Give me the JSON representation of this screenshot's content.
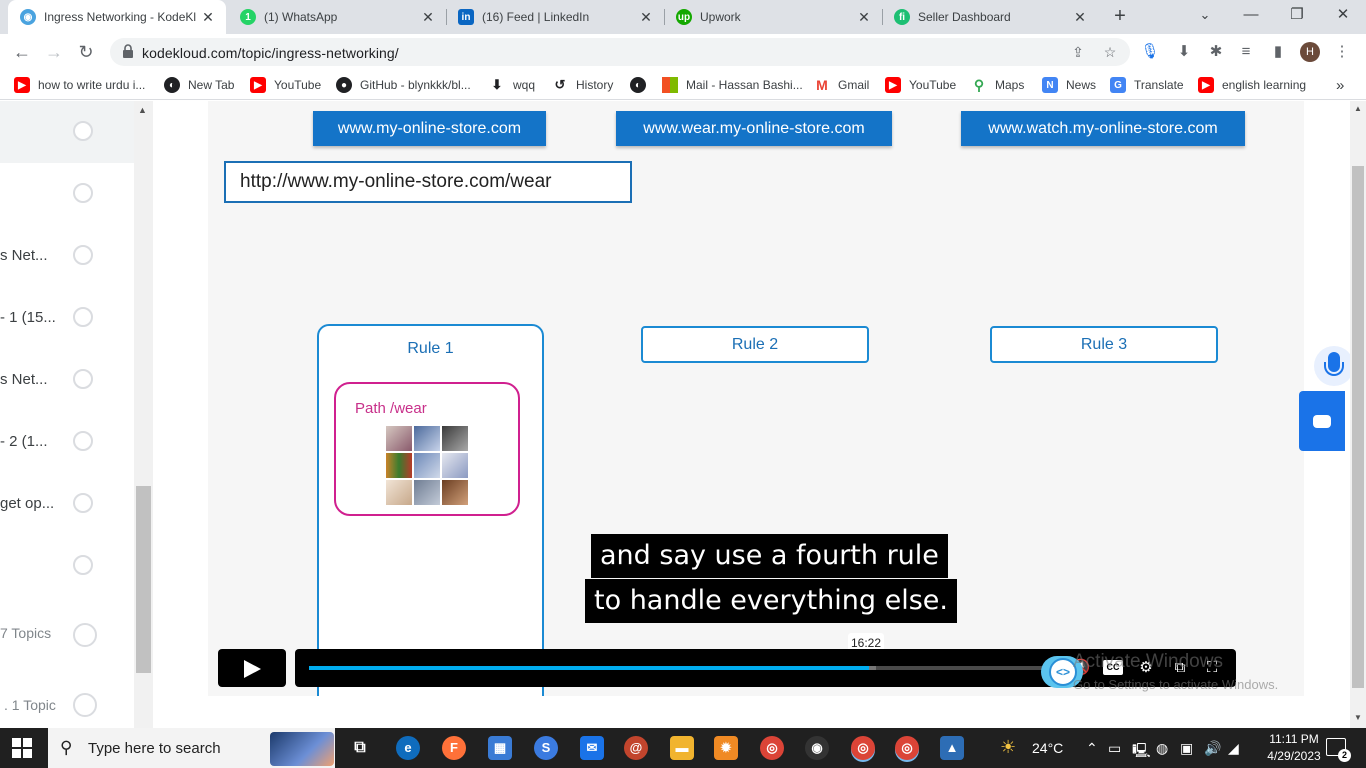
{
  "browser": {
    "tabs": [
      {
        "title": "Ingress Networking - KodeKl",
        "active": true,
        "icon": "kodekloud-icon",
        "color": "#4aa3df"
      },
      {
        "title": "(1) WhatsApp",
        "active": false,
        "icon": "whatsapp-icon",
        "color": "#25d366"
      },
      {
        "title": "(16) Feed | LinkedIn",
        "active": false,
        "icon": "linkedin-icon",
        "color": "#0a66c2"
      },
      {
        "title": "Upwork",
        "active": false,
        "icon": "upwork-icon",
        "color": "#14a800"
      },
      {
        "title": "Seller Dashboard",
        "active": false,
        "icon": "fiverr-icon",
        "color": "#1dbf73"
      }
    ],
    "new_tab": "+",
    "window_controls": {
      "minimize": "—",
      "restore": "❐",
      "close": "✕"
    },
    "url": "kodekloud.com/topic/ingress-networking/",
    "bookmarks": [
      {
        "label": "how to write urdu i...",
        "icon": "youtube-icon",
        "color": "#ff0000"
      },
      {
        "label": "New Tab",
        "icon": "globe-icon",
        "color": "#202124"
      },
      {
        "label": "YouTube",
        "icon": "youtube-icon",
        "color": "#ff0000"
      },
      {
        "label": "GitHub - blynkkk/bl...",
        "icon": "github-icon",
        "color": "#202124"
      },
      {
        "label": "wqq",
        "icon": "download-icon",
        "color": "#202124"
      },
      {
        "label": "History",
        "icon": "history-icon",
        "color": "#202124"
      },
      {
        "label": "",
        "icon": "globe-icon",
        "color": "#202124"
      },
      {
        "label": "Mail - Hassan Bashi...",
        "icon": "microsoft-icon",
        "color": "#f25022"
      },
      {
        "label": "Gmail",
        "icon": "gmail-icon",
        "color": "#ea4335"
      },
      {
        "label": "YouTube",
        "icon": "youtube-icon",
        "color": "#ff0000"
      },
      {
        "label": "Maps",
        "icon": "maps-icon",
        "color": "#34a853"
      },
      {
        "label": "News",
        "icon": "news-icon",
        "color": "#4285f4"
      },
      {
        "label": "Translate",
        "icon": "translate-icon",
        "color": "#4285f4"
      },
      {
        "label": "english learning",
        "icon": "youtube-icon",
        "color": "#ff0000"
      }
    ],
    "more_bookmarks": "»"
  },
  "sidebar": {
    "items": [
      {
        "label": ""
      },
      {
        "label": ""
      },
      {
        "label": "s Net..."
      },
      {
        "label": "- 1 (15..."
      },
      {
        "label": "s Net..."
      },
      {
        "label": "- 2 (1..."
      },
      {
        "label": "get op..."
      },
      {
        "label": ""
      },
      {
        "label": "7 Topics"
      },
      {
        "label": ". 1 Topic"
      }
    ]
  },
  "video": {
    "hosts": [
      "www.my-online-store.com",
      "www.wear.my-online-store.com",
      "www.watch.my-online-store.com"
    ],
    "url_box": "http://www.my-online-store.com/wear",
    "rules": [
      "Rule 1",
      "Rule 2",
      "Rule 3"
    ],
    "path_label": "Path /wear",
    "captions": [
      "and say use a fourth rule",
      "to handle everything else."
    ],
    "time_tooltip": "16:22",
    "progress": 0.75,
    "buffered": 0.76,
    "cc_label": "CC",
    "logo_label": "<>"
  },
  "watermark": {
    "line1": "Activate Windows",
    "line2": "Go to Settings to activate Windows."
  },
  "taskbar": {
    "search_placeholder": "Type here to search",
    "weather": "24°C",
    "time": "11:11 PM",
    "date": "4/29/2023",
    "notifications": "2"
  }
}
